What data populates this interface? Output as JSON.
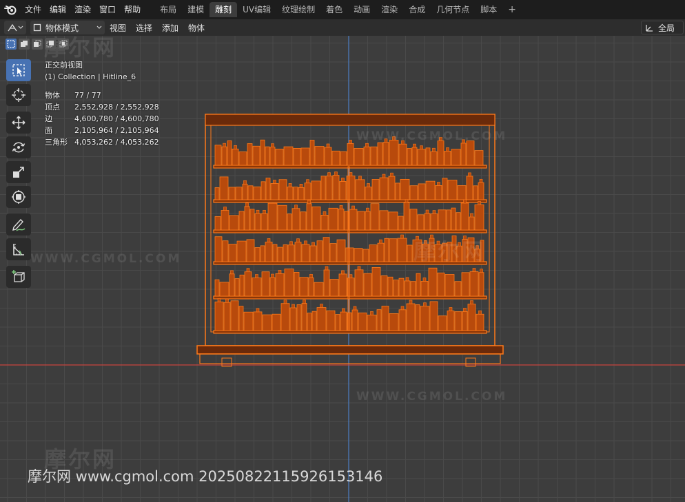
{
  "topbar": {
    "menus": [
      "文件",
      "编辑",
      "渲染",
      "窗口",
      "帮助"
    ],
    "workspace_tabs": [
      "布局",
      "建模",
      "雕刻",
      "UV编辑",
      "纹理绘制",
      "着色",
      "动画",
      "渲染",
      "合成",
      "几何节点",
      "脚本"
    ],
    "active_tab": "雕刻",
    "add_tab": "+"
  },
  "header": {
    "mode": "物体模式",
    "menus": [
      "视图",
      "选择",
      "添加",
      "物体"
    ],
    "orientation": "全局"
  },
  "viewport": {
    "view_name": "正交前视图",
    "collection": "(1) Collection | Hitline_6",
    "stats": [
      {
        "label": "物体",
        "value": "77 / 77"
      },
      {
        "label": "顶点",
        "value": "2,552,928 / 2,552,928"
      },
      {
        "label": "边",
        "value": "4,600,780 / 4,600,780"
      },
      {
        "label": "面",
        "value": "2,105,964 / 2,105,964"
      },
      {
        "label": "三角形",
        "value": "4,053,262 / 4,053,262"
      }
    ]
  },
  "tools": [
    "select-box-icon",
    "cursor-icon",
    "move-icon",
    "rotate-icon",
    "scale-icon",
    "transform-icon",
    "annotate-icon",
    "measure-icon",
    "add-cube-icon"
  ],
  "watermarks": {
    "site": "WWW.CGMOL.COM",
    "brand": "摩尔网",
    "footer": "摩尔网 www.cgmol.com 20250822115926153146"
  },
  "colors": {
    "object_outline": "#ff7a1a",
    "object_fill": "#b84a0c",
    "axis_x": "#c8443e",
    "axis_z": "#4d7fc4",
    "accent": "#4772b3"
  }
}
